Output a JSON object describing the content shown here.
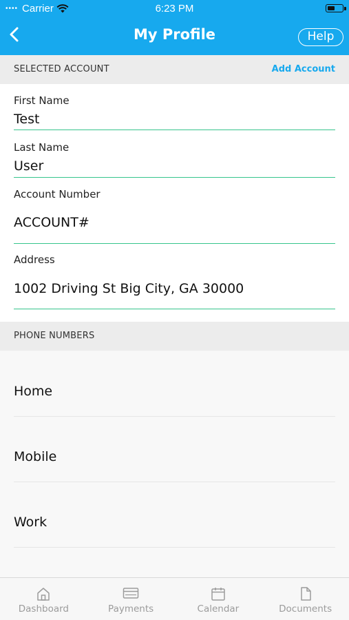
{
  "status_bar": {
    "carrier": "Carrier",
    "time": "6:23 PM"
  },
  "nav": {
    "title": "My Profile",
    "help_label": "Help"
  },
  "selected_account": {
    "header": "SELECTED ACCOUNT",
    "add_label": "Add Account"
  },
  "form": {
    "first_name": {
      "label": "First Name",
      "value": "Test"
    },
    "last_name": {
      "label": "Last Name",
      "value": "User"
    },
    "account_number": {
      "label": "Account Number",
      "value": "ACCOUNT#"
    },
    "address": {
      "label": "Address",
      "value": "1002 Driving St  Big City, GA 30000"
    }
  },
  "phones": {
    "header": "PHONE NUMBERS",
    "items": [
      {
        "label": "Home"
      },
      {
        "label": "Mobile"
      },
      {
        "label": "Work"
      }
    ]
  },
  "tabs": [
    {
      "label": "Dashboard",
      "icon": "home-icon"
    },
    {
      "label": "Payments",
      "icon": "card-icon"
    },
    {
      "label": "Calendar",
      "icon": "calendar-icon"
    },
    {
      "label": "Documents",
      "icon": "document-icon"
    }
  ],
  "colors": {
    "accent": "#17a9ee",
    "field_underline": "#35c48b",
    "tab_inactive": "#9b9b9b"
  }
}
